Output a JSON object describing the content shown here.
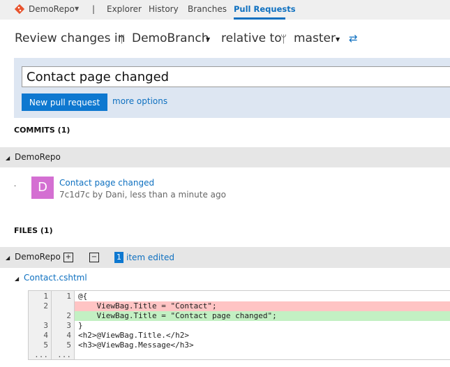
{
  "topbar": {
    "repo": "DemoRepo",
    "separator": "|",
    "tabs": [
      {
        "label": "Explorer"
      },
      {
        "label": "History"
      },
      {
        "label": "Branches"
      },
      {
        "label": "Pull Requests",
        "active": true
      }
    ]
  },
  "header": {
    "prefix": "Review changes in",
    "source_branch": "DemoBranch",
    "middle": "relative to",
    "target_branch": "master"
  },
  "form": {
    "title_value": "Contact page changed",
    "create_label": "New pull request",
    "more_options": "more options"
  },
  "commits": {
    "heading": "COMMITS (1)",
    "repo": "DemoRepo",
    "items": [
      {
        "avatar": "D",
        "avatar_color": "#d46fd2",
        "message": "Contact page changed",
        "meta": "7c1d7c by Dani, less than a minute ago"
      }
    ]
  },
  "files": {
    "heading": "FILES (1)",
    "repo": "DemoRepo",
    "badge_count": "1",
    "badge_label": "item edited",
    "file": "Contact.cshtml",
    "diff": [
      {
        "old": "1",
        "new": "1",
        "text": "@{",
        "type": "same"
      },
      {
        "old": "2",
        "new": "",
        "text": "    ViewBag.Title = \"Contact\";",
        "type": "removed"
      },
      {
        "old": "",
        "new": "2",
        "text": "    ViewBag.Title = \"Contact page changed\";",
        "type": "added"
      },
      {
        "old": "3",
        "new": "3",
        "text": "}",
        "type": "same"
      },
      {
        "old": "4",
        "new": "4",
        "text": "<h2>@ViewBag.Title.</h2>",
        "type": "same"
      },
      {
        "old": "5",
        "new": "5",
        "text": "<h3>@ViewBag.Message</h3>",
        "type": "same"
      },
      {
        "old": "...",
        "new": "...",
        "text": "",
        "type": "same"
      }
    ]
  },
  "colors": {
    "accent": "#0e70c0",
    "removed": "#ffc4c4",
    "added": "#c3f0c3"
  }
}
